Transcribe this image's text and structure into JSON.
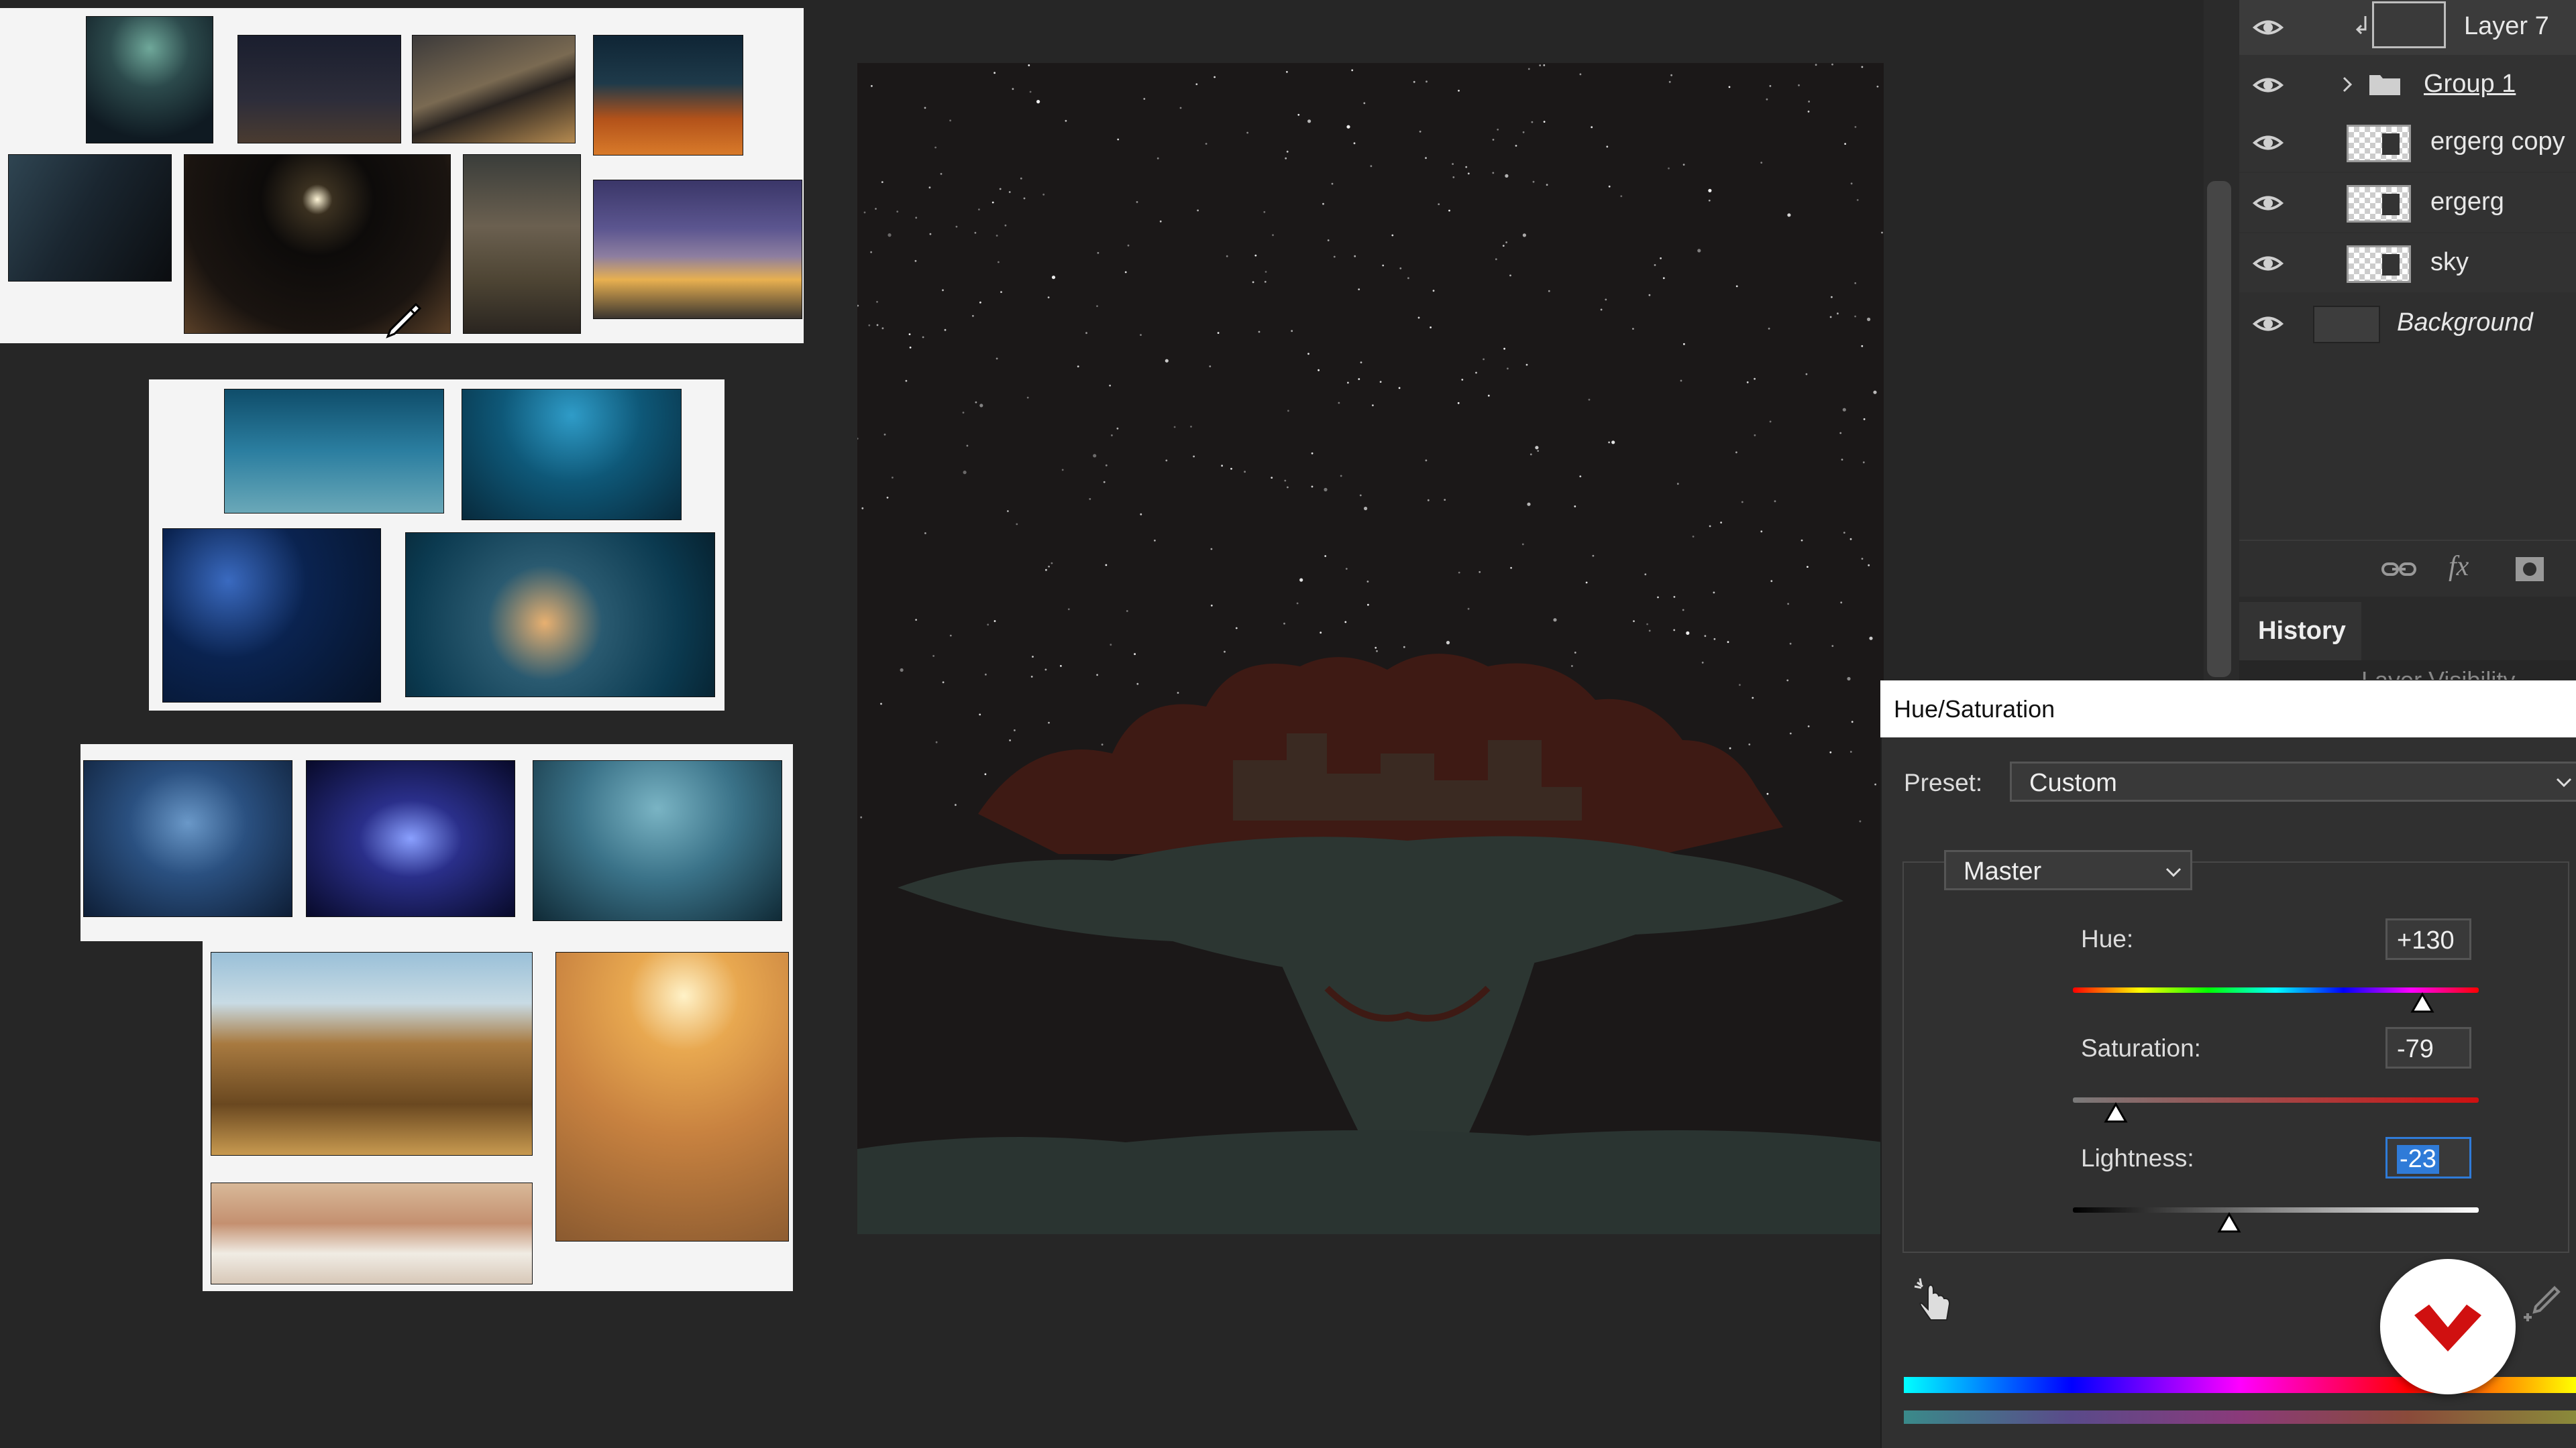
{
  "layers": [
    {
      "name": "Layer 7",
      "visible": true,
      "style": "normal"
    },
    {
      "name": "Group 1",
      "visible": true,
      "style": "underline"
    },
    {
      "name": "ergerg copy",
      "visible": true,
      "style": "normal"
    },
    {
      "name": "ergerg",
      "visible": true,
      "style": "normal"
    },
    {
      "name": "sky",
      "visible": true,
      "style": "normal"
    },
    {
      "name": "Background",
      "visible": true,
      "style": "italic"
    }
  ],
  "history": {
    "tab_label": "History",
    "peek_item": "Layer Visibility"
  },
  "dialog": {
    "title": "Hue/Saturation",
    "preset_label": "Preset:",
    "preset_value": "Custom",
    "channel_value": "Master",
    "hue": {
      "label": "Hue:",
      "value": "+130",
      "numeric": 130,
      "min": -180,
      "max": 180
    },
    "saturation": {
      "label": "Saturation:",
      "value": "-79",
      "numeric": -79,
      "min": -100,
      "max": 100
    },
    "lightness": {
      "label": "Lightness:",
      "value": "-23",
      "numeric": -23,
      "min": -100,
      "max": 100
    }
  },
  "colors": {
    "workspace": "#262626",
    "panel": "#303030",
    "canvas": "#1b1818",
    "silhouette_red": "#3e1a14",
    "silhouette_teal": "#2c3632",
    "accent_red": "#d01010"
  }
}
